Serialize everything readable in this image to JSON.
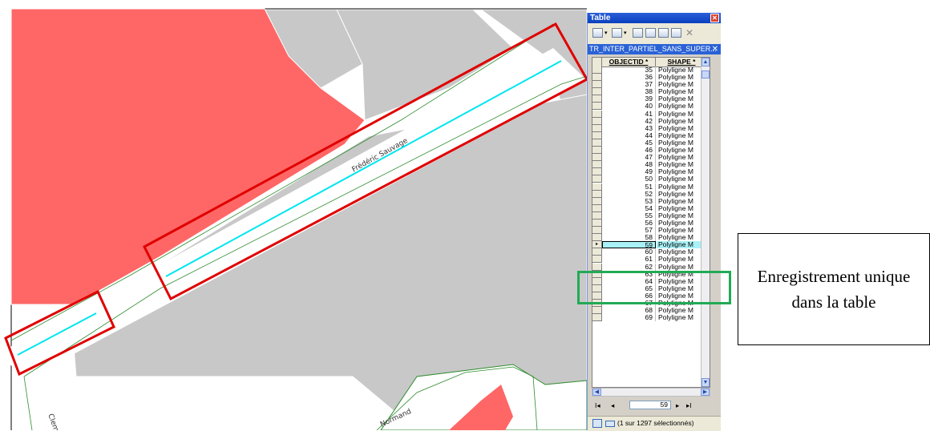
{
  "map": {
    "street_labels": {
      "main": "Frédéric Sauvage",
      "bottom_left": "Clement",
      "bottom_center": "Normand"
    },
    "colors": {
      "building_red": "#ff6666",
      "parcel_gray": "#c8c8c8",
      "line_cyan": "#00e5f0",
      "highlight_red": "#e00000",
      "road_green": "#2e8b2e"
    }
  },
  "table_window": {
    "title": "Table",
    "close_icon": "close-icon",
    "layer_tab": "TR_INTER_PARTIEL_SANS_SUPER...",
    "columns": [
      "OBJECTID *",
      "SHAPE *"
    ],
    "rows": [
      {
        "id": "35",
        "shape": "Polyligne M"
      },
      {
        "id": "36",
        "shape": "Polyligne M"
      },
      {
        "id": "37",
        "shape": "Polyligne M"
      },
      {
        "id": "38",
        "shape": "Polyligne M"
      },
      {
        "id": "39",
        "shape": "Polyligne M"
      },
      {
        "id": "40",
        "shape": "Polyligne M"
      },
      {
        "id": "41",
        "shape": "Polyligne M"
      },
      {
        "id": "42",
        "shape": "Polyligne M"
      },
      {
        "id": "43",
        "shape": "Polyligne M"
      },
      {
        "id": "44",
        "shape": "Polyligne M"
      },
      {
        "id": "45",
        "shape": "Polyligne M"
      },
      {
        "id": "46",
        "shape": "Polyligne M"
      },
      {
        "id": "47",
        "shape": "Polyligne M"
      },
      {
        "id": "48",
        "shape": "Polyligne M"
      },
      {
        "id": "49",
        "shape": "Polyligne M"
      },
      {
        "id": "50",
        "shape": "Polyligne M"
      },
      {
        "id": "51",
        "shape": "Polyligne M"
      },
      {
        "id": "52",
        "shape": "Polyligne M"
      },
      {
        "id": "53",
        "shape": "Polyligne M"
      },
      {
        "id": "54",
        "shape": "Polyligne M"
      },
      {
        "id": "55",
        "shape": "Polyligne M"
      },
      {
        "id": "56",
        "shape": "Polyligne M"
      },
      {
        "id": "57",
        "shape": "Polyligne M"
      },
      {
        "id": "58",
        "shape": "Polyligne M"
      },
      {
        "id": "59",
        "shape": "Polyligne M",
        "selected": true
      },
      {
        "id": "60",
        "shape": "Polyligne M"
      },
      {
        "id": "61",
        "shape": "Polyligne M"
      },
      {
        "id": "62",
        "shape": "Polyligne M"
      },
      {
        "id": "63",
        "shape": "Polyligne M"
      },
      {
        "id": "64",
        "shape": "Polyligne M"
      },
      {
        "id": "65",
        "shape": "Polyligne M"
      },
      {
        "id": "66",
        "shape": "Polyligne M"
      },
      {
        "id": "67",
        "shape": "Polyligne M"
      },
      {
        "id": "68",
        "shape": "Polyligne M"
      },
      {
        "id": "69",
        "shape": "Polyligne M"
      }
    ],
    "navigation": {
      "first": "I◂",
      "prev": "◂",
      "current_record": "59",
      "next": "▸",
      "last": "▸I"
    },
    "status": "(1 sur 1297 sélectionnés)",
    "selected_row_color": "#a8f1f6",
    "title_bar_color": "#0a3fbf"
  },
  "annotation": {
    "text": "Enregistrement unique dans la table",
    "highlight_color": "#22aa55"
  }
}
